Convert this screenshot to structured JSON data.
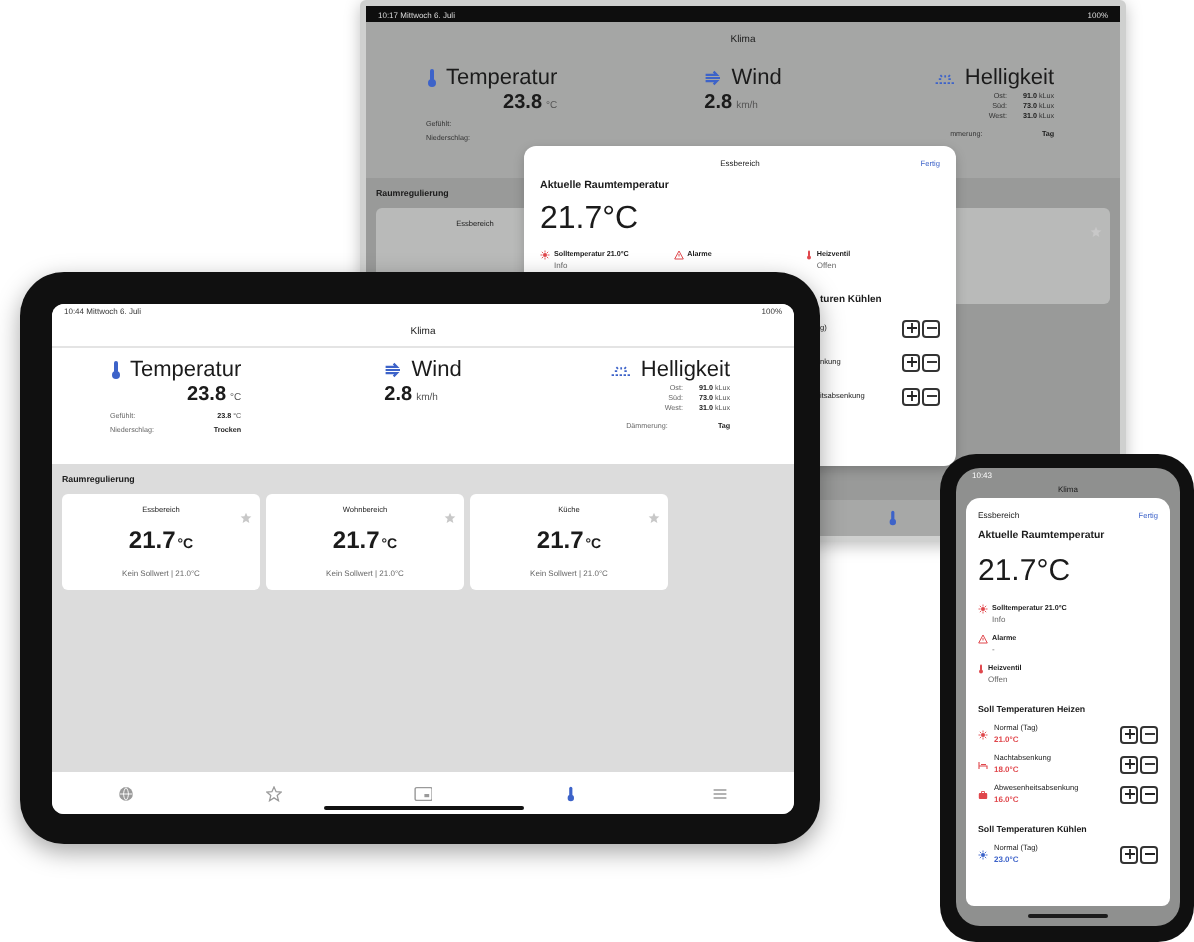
{
  "back_tablet": {
    "status_time": "10:17 Mittwoch 6. Juli",
    "status_battery": "100%",
    "title": "Klima",
    "temperature": {
      "label": "Temperatur",
      "value": "23.8",
      "unit": "°C",
      "rows": [
        {
          "label": "Gefühlt:"
        },
        {
          "label": "Niederschlag:"
        }
      ]
    },
    "wind": {
      "label": "Wind",
      "value": "2.8",
      "unit": "km/h"
    },
    "brightness": {
      "label": "Helligkeit",
      "rows": [
        {
          "label": "Ost:",
          "value": "91.0",
          "unit": "kLux"
        },
        {
          "label": "Süd:",
          "value": "73.0",
          "unit": "kLux"
        },
        {
          "label": "West:",
          "value": "31.0",
          "unit": "kLux"
        }
      ],
      "twilight": {
        "label": "mmerung:",
        "value": "Tag"
      }
    },
    "section": "Raumregulierung",
    "cards": [
      {
        "title": "Essbereich"
      }
    ],
    "tabs": [
      {
        "kind": "climate",
        "selected": true
      }
    ],
    "modal": {
      "title": "Essbereich",
      "done": "Fertig",
      "heading": "Aktuelle Raumtemperatur",
      "value": "21.7°C",
      "status": [
        {
          "kind": "setpoint",
          "label": "Solltemperatur 21.0°C",
          "sub": "Info"
        },
        {
          "kind": "alarm",
          "label": "Alarme"
        },
        {
          "kind": "valve",
          "label": "Heizventil",
          "sub": "Offen"
        }
      ],
      "cooling": {
        "heading": "turen Kühlen",
        "rows": [
          {
            "label": "g)"
          },
          {
            "label": "nkung"
          },
          {
            "label": "itsabsenkung"
          }
        ]
      }
    }
  },
  "front_tablet": {
    "status_time": "10:44 Mittwoch 6. Juli",
    "status_battery": "100%",
    "title": "Klima",
    "temperature": {
      "label": "Temperatur",
      "value": "23.8",
      "unit": "°C",
      "rows": [
        {
          "label": "Gefühlt:",
          "value": "23.8",
          "unit": "°C"
        },
        {
          "label": "Niederschlag:",
          "value": "Trocken"
        }
      ]
    },
    "wind": {
      "label": "Wind",
      "value": "2.8",
      "unit": "km/h"
    },
    "brightness": {
      "label": "Helligkeit",
      "rows": [
        {
          "label": "Ost:",
          "value": "91.0",
          "unit": "kLux"
        },
        {
          "label": "Süd:",
          "value": "73.0",
          "unit": "kLux"
        },
        {
          "label": "West:",
          "value": "31.0",
          "unit": "kLux"
        }
      ],
      "twilight": {
        "label": "Dämmerung:",
        "value": "Tag"
      }
    },
    "section": "Raumregulierung",
    "cards": [
      {
        "title": "Essbereich",
        "value": "21.7",
        "unit": "°C",
        "footer": "Kein Sollwert | 21.0°C",
        "favorite": false
      },
      {
        "title": "Wohnbereich",
        "value": "21.7",
        "unit": "°C",
        "footer": "Kein Sollwert | 21.0°C",
        "favorite": false
      },
      {
        "title": "Küche",
        "value": "21.7",
        "unit": "°C",
        "footer": "Kein Sollwert | 21.0°C",
        "favorite": false
      }
    ],
    "tabs": [
      {
        "kind": "globe",
        "selected": false
      },
      {
        "kind": "star",
        "selected": false
      },
      {
        "kind": "screen",
        "selected": false
      },
      {
        "kind": "climate",
        "selected": true
      },
      {
        "kind": "list",
        "selected": false
      }
    ]
  },
  "phone": {
    "status_time": "10:43",
    "title": "Klima",
    "sheet": {
      "title": "Essbereich",
      "done": "Fertig",
      "heading": "Aktuelle Raumtemperatur",
      "value": "21.7°C",
      "status": [
        {
          "kind": "setpoint",
          "label": "Solltemperatur 21.0°C",
          "sub": "Info"
        },
        {
          "kind": "alarm",
          "label": "Alarme",
          "sub": "-"
        },
        {
          "kind": "valve",
          "label": "Heizventil",
          "sub": "Offen"
        }
      ],
      "sections": [
        {
          "kind": "heat",
          "heading": "Soll Temperaturen Heizen",
          "rows": [
            {
              "kind": "day",
              "label": "Normal (Tag)",
              "value": "21.0°C"
            },
            {
              "kind": "night",
              "label": "Nachtabsenkung",
              "value": "18.0°C"
            },
            {
              "kind": "away",
              "label": "Abwesenheitsabsenkung",
              "value": "16.0°C"
            }
          ]
        },
        {
          "kind": "cool",
          "heading": "Soll Temperaturen Kühlen",
          "rows": [
            {
              "kind": "day",
              "label": "Normal (Tag)",
              "value": "23.0°C"
            }
          ]
        }
      ]
    }
  }
}
